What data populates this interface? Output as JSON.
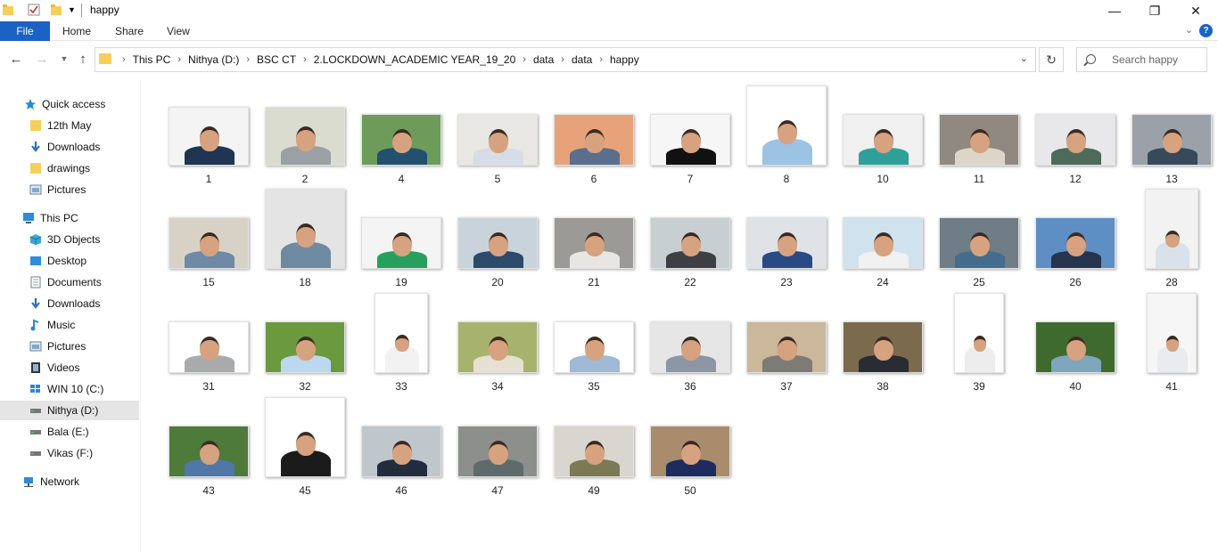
{
  "window": {
    "title": "happy"
  },
  "ribbon": {
    "file": "File",
    "tabs": [
      "Home",
      "Share",
      "View"
    ]
  },
  "address": {
    "crumbs": [
      "This PC",
      "Nithya (D:)",
      "BSC CT",
      "2.LOCKDOWN_ACADEMIC YEAR_19_20",
      "data",
      "data",
      "happy"
    ]
  },
  "search": {
    "placeholder": "Search happy"
  },
  "sidebar": {
    "quick_access": "Quick access",
    "quick_items": [
      "12th May",
      "Downloads",
      "drawings",
      "Pictures"
    ],
    "this_pc": "This PC",
    "pc_items": [
      "3D Objects",
      "Desktop",
      "Documents",
      "Downloads",
      "Music",
      "Pictures",
      "Videos",
      "WIN 10 (C:)",
      "Nithya (D:)",
      "Bala (E:)",
      "Vikas (F:)"
    ],
    "network": "Network"
  },
  "files": [
    {
      "name": "1",
      "bg": "#f4f4f4",
      "shirt": "#1f3552"
    },
    {
      "name": "2",
      "bg": "#d9dccf",
      "shirt": "#9aa0a4"
    },
    {
      "name": "4",
      "bg": "#6d9c5a",
      "shirt": "#23506c"
    },
    {
      "name": "5",
      "bg": "#e9e7e3",
      "shirt": "#d6dde6"
    },
    {
      "name": "6",
      "bg": "#e8a27a",
      "shirt": "#5b6e8c"
    },
    {
      "name": "7",
      "bg": "#f6f6f6",
      "shirt": "#111111"
    },
    {
      "name": "8",
      "bg": "#ffffff",
      "shirt": "#9cc3e4"
    },
    {
      "name": "10",
      "bg": "#f0f0f0",
      "shirt": "#2f9f9a"
    },
    {
      "name": "11",
      "bg": "#8f8982",
      "shirt": "#ddd6c8"
    },
    {
      "name": "12",
      "bg": "#e8e8ea",
      "shirt": "#4e6a58"
    },
    {
      "name": "13",
      "bg": "#9aa1a8",
      "shirt": "#37495b"
    },
    {
      "name": "15",
      "bg": "#d8d2c6",
      "shirt": "#6e8aa6"
    },
    {
      "name": "18",
      "bg": "#e4e4e4",
      "shirt": "#6d8aa0"
    },
    {
      "name": "19",
      "bg": "#f4f4f4",
      "shirt": "#27a05d"
    },
    {
      "name": "20",
      "bg": "#c9d3dc",
      "shirt": "#2c4a6a"
    },
    {
      "name": "21",
      "bg": "#9c9a96",
      "shirt": "#e8e6e2"
    },
    {
      "name": "22",
      "bg": "#c7cfd2",
      "shirt": "#3d3f44"
    },
    {
      "name": "23",
      "bg": "#dfe3e8",
      "shirt": "#2a4a86"
    },
    {
      "name": "24",
      "bg": "#cfe2ee",
      "shirt": "#f1f1f1"
    },
    {
      "name": "25",
      "bg": "#6f7e86",
      "shirt": "#446c8c"
    },
    {
      "name": "26",
      "bg": "#5d8ec4",
      "shirt": "#27344e"
    },
    {
      "name": "28",
      "bg": "#f2f2f2",
      "shirt": "#d9e2ea"
    },
    {
      "name": "31",
      "bg": "#ffffff",
      "shirt": "#a8aaab"
    },
    {
      "name": "32",
      "bg": "#6b9a3e",
      "shirt": "#bcd7ee"
    },
    {
      "name": "33",
      "bg": "#ffffff",
      "shirt": "#f2f2f2"
    },
    {
      "name": "34",
      "bg": "#a7b36c",
      "shirt": "#e5e0d2"
    },
    {
      "name": "35",
      "bg": "#ffffff",
      "shirt": "#9fb9d6"
    },
    {
      "name": "36",
      "bg": "#e6e6e6",
      "shirt": "#8c96a5"
    },
    {
      "name": "37",
      "bg": "#cbb79a",
      "shirt": "#7d7b78"
    },
    {
      "name": "38",
      "bg": "#7b6a4c",
      "shirt": "#2a2c33"
    },
    {
      "name": "39",
      "bg": "#ffffff",
      "shirt": "#ededed"
    },
    {
      "name": "40",
      "bg": "#3f6a2e",
      "shirt": "#7ea6bd"
    },
    {
      "name": "41",
      "bg": "#f6f6f6",
      "shirt": "#e8ecf0"
    },
    {
      "name": "43",
      "bg": "#4e7a3a",
      "shirt": "#5077a6"
    },
    {
      "name": "45",
      "bg": "#ffffff",
      "shirt": "#1b1b1b"
    },
    {
      "name": "46",
      "bg": "#c0c7cc",
      "shirt": "#232c3d"
    },
    {
      "name": "47",
      "bg": "#8d8f8c",
      "shirt": "#5f6a6c"
    },
    {
      "name": "49",
      "bg": "#d9d6d0",
      "shirt": "#7c7a55"
    },
    {
      "name": "50",
      "bg": "#a88c6c",
      "shirt": "#1f2b5e"
    }
  ],
  "colors": {
    "accent": "#1a62c6",
    "folder": "#f6cf5b",
    "selected": "#e5e5e5"
  }
}
